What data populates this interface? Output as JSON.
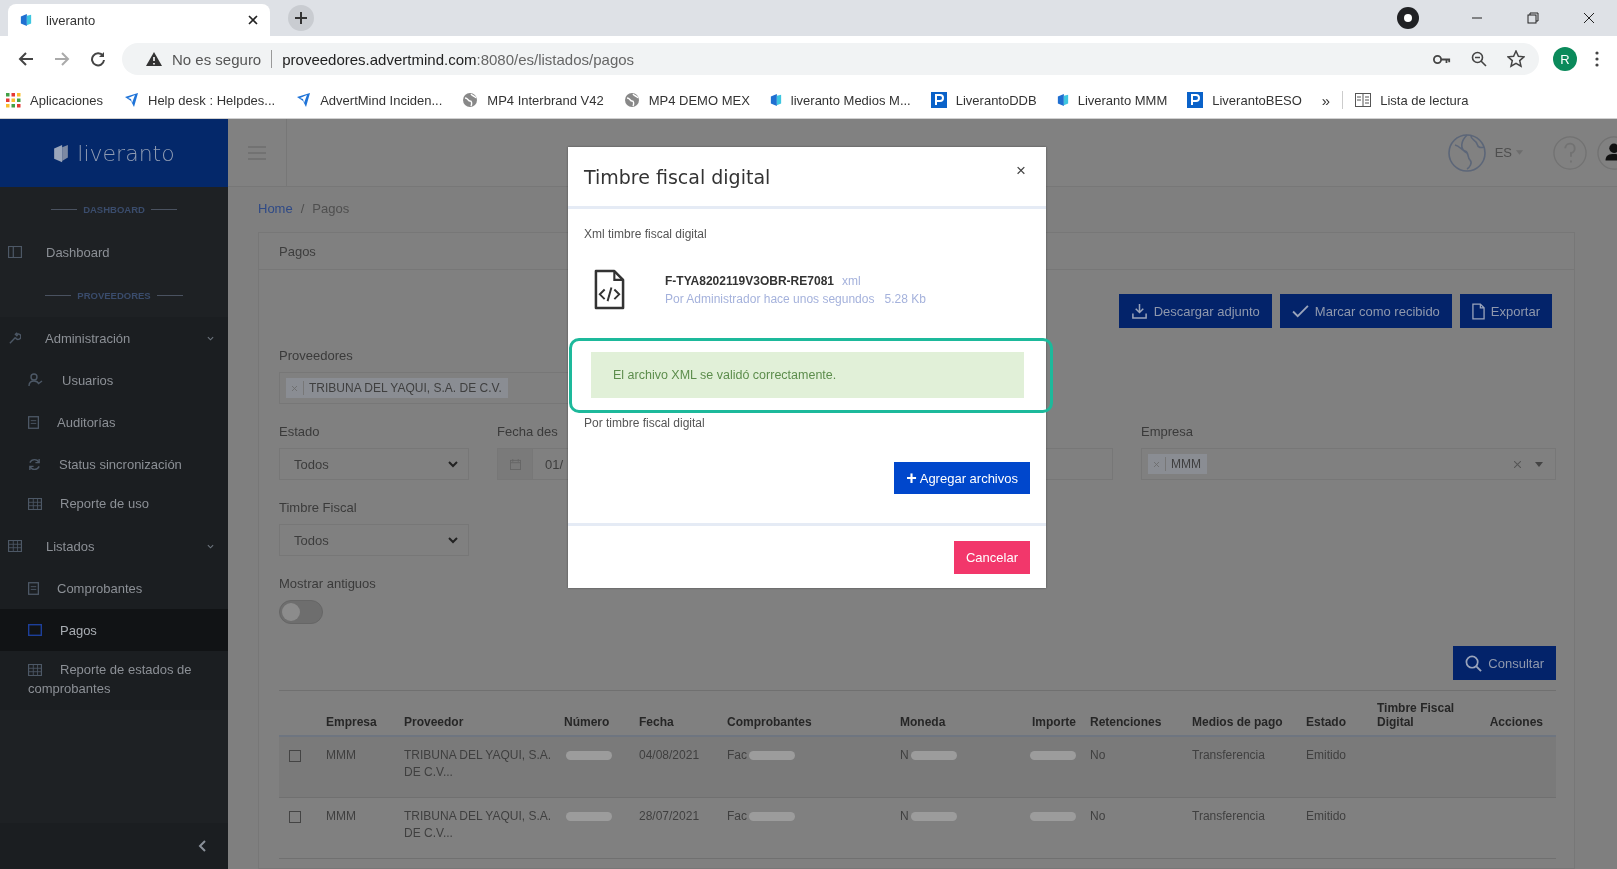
{
  "browser": {
    "tab_title": "liveranto",
    "security_label": "No es seguro",
    "url_host": "proveedores.advertmind.com",
    "url_rest": ":8080/es/listados/pagos",
    "profile_initial": "R",
    "bookmarks": [
      {
        "label": "Aplicaciones"
      },
      {
        "label": "Help desk : Helpdes..."
      },
      {
        "label": "AdvertMind Inciden..."
      },
      {
        "label": "MP4 Interbrand V42"
      },
      {
        "label": "MP4 DEMO MEX"
      },
      {
        "label": "liveranto Medios M..."
      },
      {
        "label": "LiverantoDDB"
      },
      {
        "label": "Liveranto MMM"
      },
      {
        "label": "LiverantoBESO"
      }
    ],
    "more_bookmarks": "»",
    "reading_list": "Lista de lectura"
  },
  "app": {
    "logo": "liveranto",
    "language": "ES"
  },
  "sidebar": {
    "items": [
      {
        "kind": "section",
        "label": "DASHBOARD"
      },
      {
        "kind": "link",
        "label": "Dashboard",
        "selected": false
      },
      {
        "kind": "section",
        "label": "PROVEEDORES"
      },
      {
        "kind": "group",
        "label": "Administración",
        "expanded": true,
        "children": [
          {
            "label": "Usuarios",
            "selected": false
          },
          {
            "label": "Auditorías",
            "selected": false
          },
          {
            "label": "Status sincronización",
            "selected": false
          },
          {
            "label": "Reporte de uso",
            "selected": false
          }
        ]
      },
      {
        "kind": "group",
        "label": "Listados",
        "expanded": true,
        "children": [
          {
            "label": "Comprobantes",
            "selected": false
          },
          {
            "label": "Pagos",
            "selected": true
          },
          {
            "label": "Reporte de estados de comprobantes",
            "selected": false
          }
        ]
      }
    ]
  },
  "breadcrumb": [
    {
      "label": "Home"
    },
    {
      "label": "Pagos"
    }
  ],
  "breadcrumb_separator": "/",
  "card_title": "Pagos",
  "actions": [
    {
      "label": "Descargar adjunto"
    },
    {
      "label": "Marcar como recibido"
    },
    {
      "label": "Exportar"
    }
  ],
  "filters": {
    "proveedores": {
      "label": "Proveedores",
      "tags": [
        "TRIBUNA DEL YAQUI, S.A. DE C.V."
      ]
    },
    "estado": {
      "label": "Estado",
      "value": "Todos"
    },
    "fecha_desde": {
      "label": "Fecha des",
      "value": "01/"
    },
    "empresa": {
      "label": "Empresa",
      "tags": [
        "MMM"
      ]
    },
    "timbre_fiscal": {
      "label": "Timbre Fiscal",
      "value": "Todos"
    },
    "mostrar_antiguos": {
      "label": "Mostrar antiguos",
      "on": false
    }
  },
  "query_button": "Consultar",
  "table": {
    "columns": [
      "Empresa",
      "Proveedor",
      "Número",
      "Fecha",
      "Comprobantes",
      "Moneda",
      "Importe",
      "Retenciones",
      "Medios de pago",
      "Estado",
      "Timbre Fiscal Digital",
      "Acciones"
    ],
    "rows": [
      {
        "checked": false,
        "cells": [
          {
            "text": "MMM"
          },
          {
            "text": "TRIBUNA DEL YAQUI, S.A. DE C.V..."
          },
          {
            "blurred": true
          },
          {
            "text": "04/08/2021"
          },
          {
            "text": "Fac",
            "blurred": true
          },
          {
            "blurred": true,
            "text": "N"
          },
          {
            "blurred": true
          },
          {
            "text": "No"
          },
          {
            "text": "Transferencia"
          },
          {
            "text": "Emitido"
          },
          {},
          {}
        ]
      },
      {
        "checked": false,
        "cells": [
          {
            "text": "MMM"
          },
          {
            "text": "TRIBUNA DEL YAQUI, S.A. DE C.V..."
          },
          {
            "blurred": true
          },
          {
            "text": "28/07/2021"
          },
          {
            "text": "Fac",
            "blurred": true
          },
          {
            "blurred": true,
            "text": "N"
          },
          {
            "blurred": true
          },
          {
            "text": "No"
          },
          {
            "text": "Transferencia"
          },
          {
            "text": "Emitido"
          },
          {},
          {}
        ]
      }
    ]
  },
  "modal": {
    "title": "Timbre fiscal digital",
    "close": "×",
    "section_label": "Xml timbre fiscal digital",
    "file_name": "F-TYA8202119V3OBR-RE7081",
    "file_type": "xml",
    "file_meta": "Por Administrador hace unos segundos",
    "file_size": "5.28 Kb",
    "alert": "El archivo XML se validó correctamente.",
    "second_label": "Por timbre fiscal digital",
    "add_button": "Agregar archivos",
    "add_icon": "+",
    "cancel_button": "Cancelar"
  }
}
